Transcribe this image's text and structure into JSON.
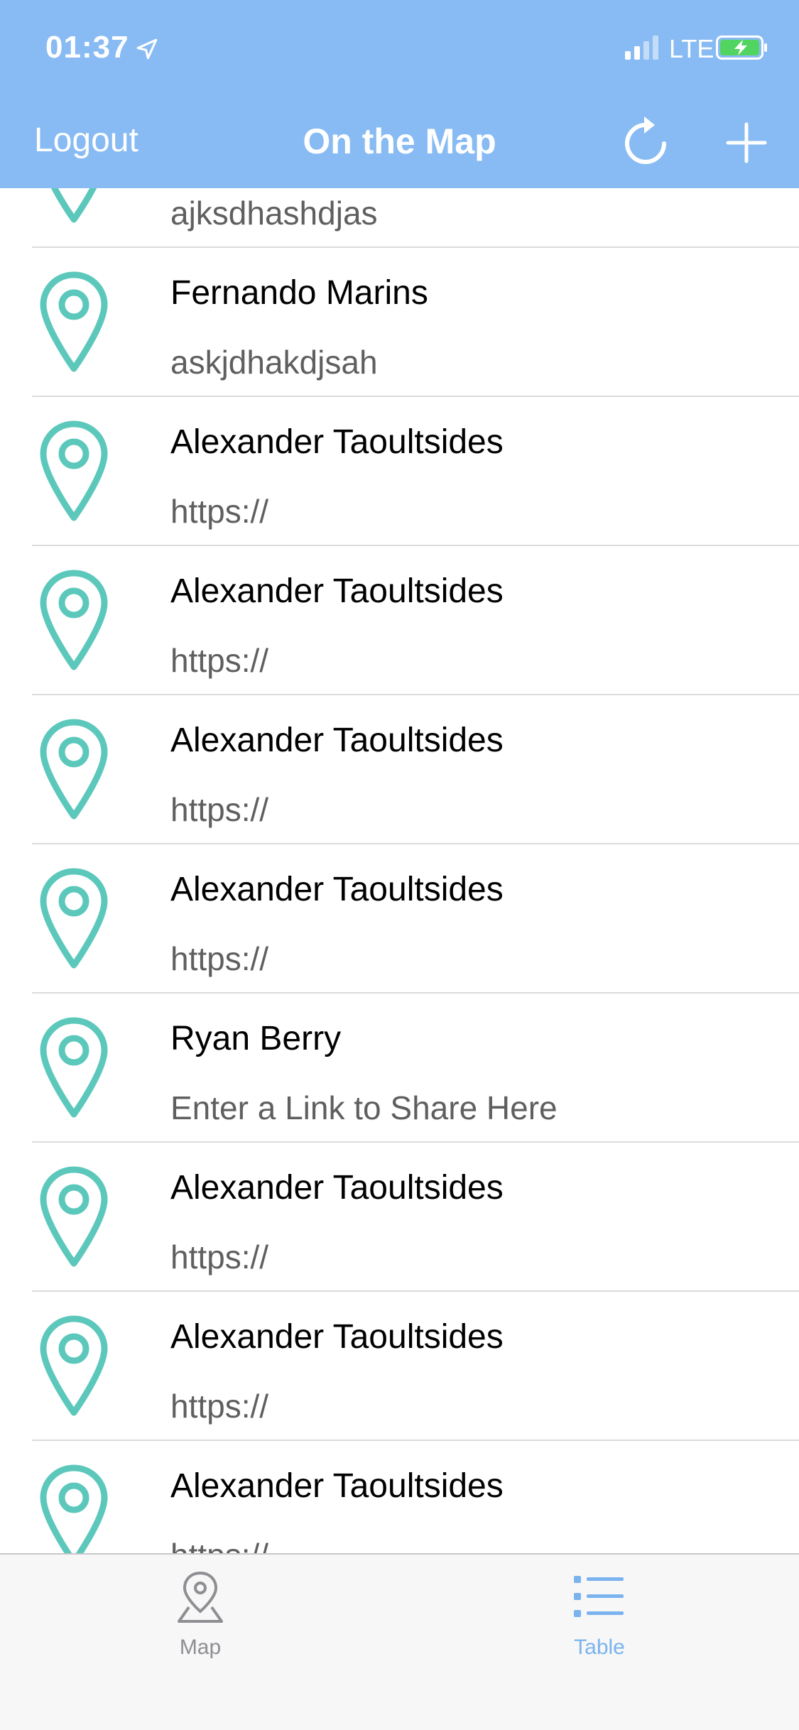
{
  "status_bar": {
    "time": "01:37",
    "network": "LTE"
  },
  "nav": {
    "logout_label": "Logout",
    "title": "On the Map"
  },
  "rows": [
    {
      "name": "",
      "link": "ajksdhashdjas"
    },
    {
      "name": "Fernando Marins",
      "link": "askjdhakdjsah"
    },
    {
      "name": "Alexander Taoultsides",
      "link": "https://"
    },
    {
      "name": "Alexander Taoultsides",
      "link": "https://"
    },
    {
      "name": "Alexander Taoultsides",
      "link": "https://"
    },
    {
      "name": "Alexander Taoultsides",
      "link": "https://"
    },
    {
      "name": "Ryan Berry",
      "link": "Enter a Link to Share Here"
    },
    {
      "name": "Alexander Taoultsides",
      "link": "https://"
    },
    {
      "name": "Alexander Taoultsides",
      "link": "https://"
    },
    {
      "name": "Alexander Taoultsides",
      "link": "https://"
    }
  ],
  "tabs": [
    {
      "label": "Map",
      "icon": "map-pin-icon",
      "selected": false
    },
    {
      "label": "Table",
      "icon": "list-icon",
      "selected": true
    }
  ],
  "colors": {
    "nav_background": "#88bbf3",
    "pin": "#5cc8bb",
    "tab_selected": "#7ab3ee",
    "tab_unselected": "#8e8e93"
  }
}
